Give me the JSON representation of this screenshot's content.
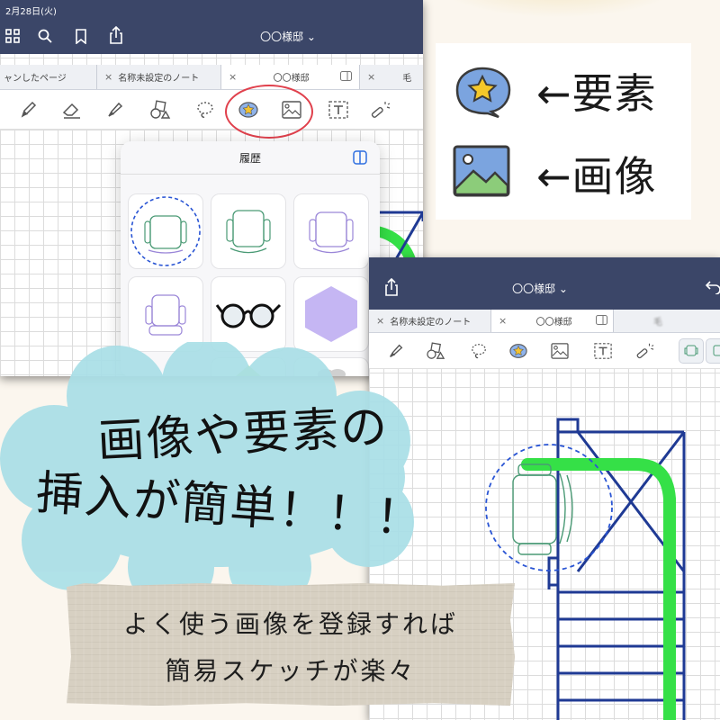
{
  "colors": {
    "navbar": "#3b4668",
    "tabbar": "#eef0f4",
    "highlight_ring": "#e0404c",
    "wall_blue": "#1f3a94",
    "path_green": "#35e047",
    "chair_green": "#4a9a75",
    "chair_purple": "#9a86d8",
    "hexagon": "#c5b6f3",
    "cloud": "#a9dfe7",
    "note_paper": "#d7d0c2"
  },
  "screenshot1": {
    "status_date": "2月28日(火)",
    "title": "〇〇様邸 ⌄",
    "nav_icons": [
      "grid-icon",
      "search-icon",
      "bookmark-icon",
      "share-icon"
    ],
    "tabs": [
      {
        "label": "ャンしたページ",
        "close": ""
      },
      {
        "label": "名称未設定のノート",
        "close": "×"
      },
      {
        "label": "〇〇様邸",
        "close": "×",
        "active": true
      },
      {
        "label": "毛",
        "close": "×"
      }
    ],
    "tools": [
      "pen-icon",
      "eraser-icon",
      "highlighter-icon",
      "shapes-icon",
      "lasso-icon",
      "element-sticker-icon",
      "image-icon",
      "textbox-icon",
      "laser-pointer-icon"
    ],
    "popover": {
      "title": "履歴",
      "icon": "panel-icon",
      "items": [
        {
          "name": "chair-green-selected",
          "color": "green",
          "selected": true
        },
        {
          "name": "chair-green",
          "color": "green",
          "selected": false
        },
        {
          "name": "chair-purple",
          "color": "purple",
          "selected": false
        },
        {
          "name": "chair-purple-topview",
          "color": "purple",
          "selected": false
        },
        {
          "name": "glasses",
          "color": "black",
          "selected": false
        },
        {
          "name": "hexagon",
          "color": "lavender",
          "selected": false
        }
      ]
    }
  },
  "legend": {
    "element_label": "←要素",
    "image_label": "←画像",
    "element_icon": "element-sticker-icon",
    "image_icon": "image-icon"
  },
  "screenshot2": {
    "title": "〇〇様邸 ⌄",
    "nav_icons": [
      "share-icon",
      "undo-icon"
    ],
    "tabs": [
      {
        "label": "名称未設定のノート",
        "close": "×"
      },
      {
        "label": "〇〇様邸",
        "close": "×",
        "active": true
      },
      {
        "label": "毛",
        "close": ""
      }
    ],
    "tools": [
      "highlighter-icon",
      "shapes-icon",
      "lasso-icon",
      "element-sticker-icon",
      "image-icon",
      "textbox-icon",
      "laser-pointer-icon"
    ]
  },
  "cloud": {
    "line1": "画像や要素の",
    "line2": "挿入が簡単！！！"
  },
  "note": {
    "line1": "よく使う画像を登録すれば",
    "line2": "簡易スケッチが楽々"
  }
}
